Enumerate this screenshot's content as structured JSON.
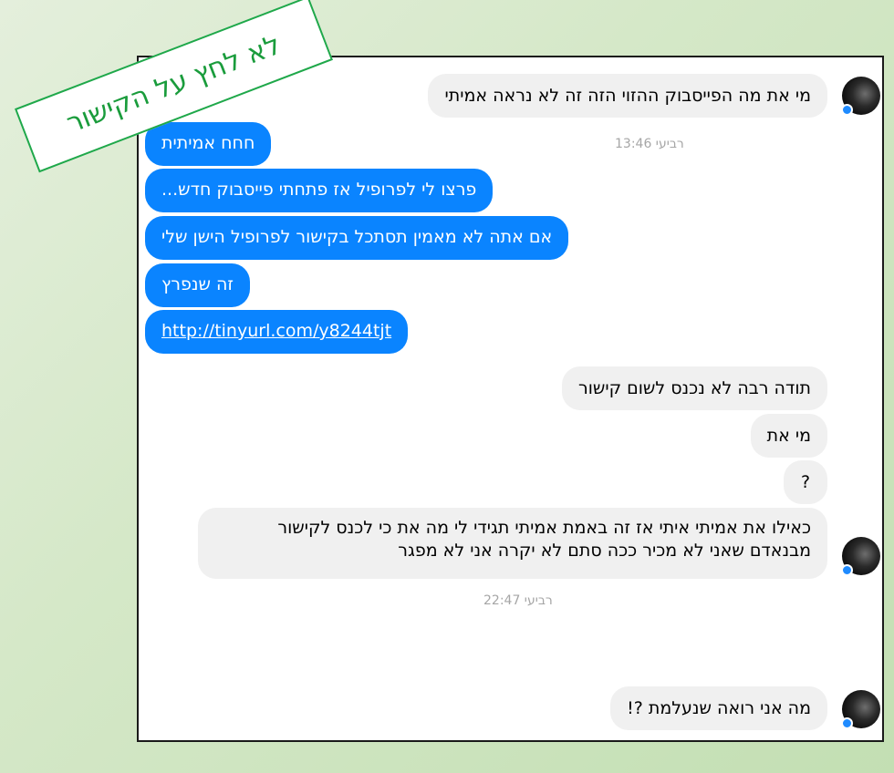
{
  "banner": {
    "text": "לא לחץ על הקישור"
  },
  "messages": [
    {
      "side": "in",
      "text": "מי את מה הפייסבוק ההזוי הזה זה לא נראה אמיתי"
    },
    {
      "side": "out",
      "text": "חחח אמיתית"
    },
    {
      "side": "out",
      "text": "פרצו לי לפרופיל אז פתחתי פייסבוק חדש..."
    },
    {
      "side": "out",
      "text": "אם אתה לא מאמין תסתכל בקישור לפרופיל הישן שלי"
    },
    {
      "side": "out",
      "text": "זה שנפרץ"
    },
    {
      "side": "out",
      "text": "http://tinyurl.com/y8244tjt"
    },
    {
      "side": "in",
      "text": "תודה רבה לא נכנס לשום קישור"
    },
    {
      "side": "in",
      "text": "מי את"
    },
    {
      "side": "in",
      "text": "?"
    },
    {
      "side": "in",
      "text": "כאילו את אמיתי איתי אז זה באמת אמיתי תגידי לי מה את כי לכנס לקישור מבנאדם שאני לא מכיר ככה סתם לא יקרה אני לא מפגר"
    },
    {
      "side": "in",
      "text": "מה אני רואה שנעלמת ?!"
    }
  ],
  "timestamps": [
    "רביעי 13:46",
    "רביעי 22:47"
  ],
  "colors": {
    "outgoing_bubble": "#0a84ff",
    "incoming_bubble": "#f0f0f0",
    "banner_green": "#1a9c3c",
    "background_green": "#d5e8c8"
  },
  "icons": [
    "avatar",
    "online-dot-icon"
  ]
}
